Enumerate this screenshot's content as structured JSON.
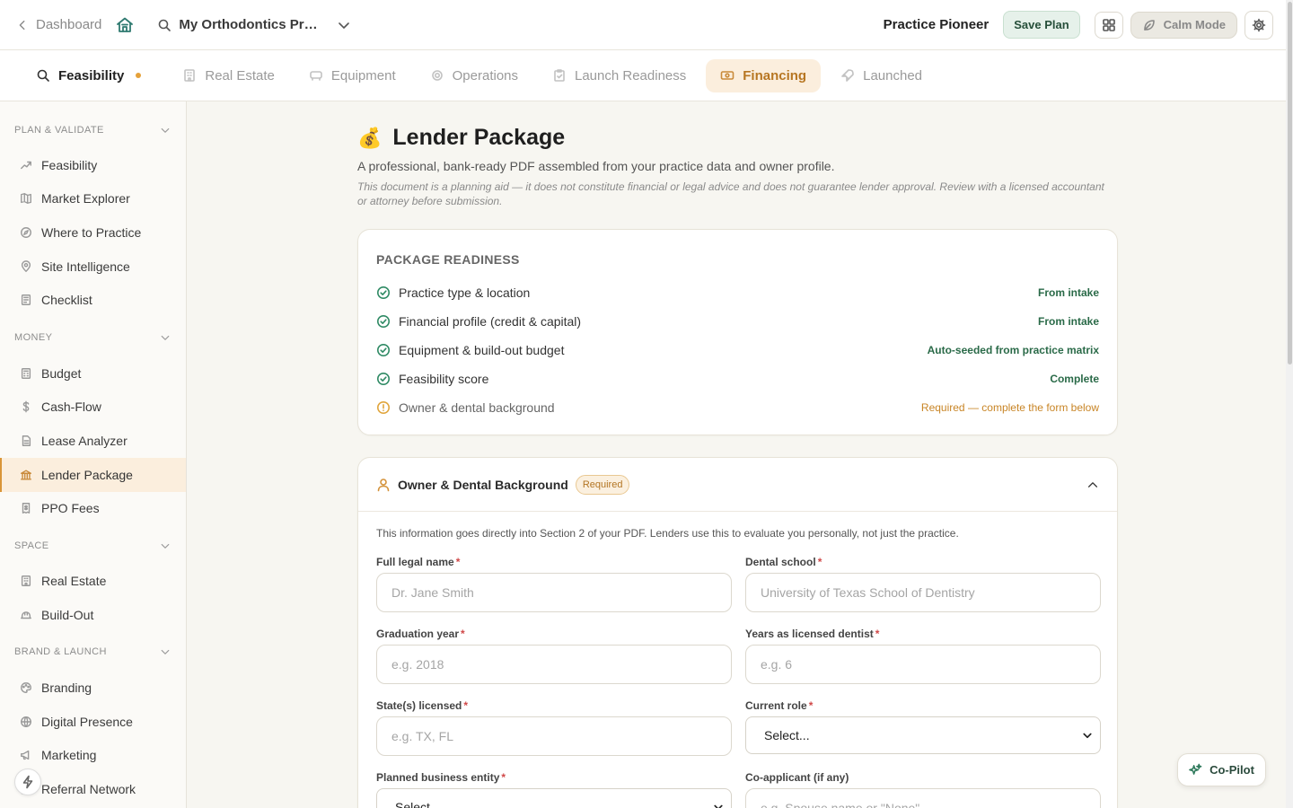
{
  "topbar": {
    "back_label": "Dashboard",
    "project_name": "My Orthodontics Practi...",
    "plan_name": "Practice Pioneer",
    "save_label": "Save Plan",
    "calm_label": "Calm Mode"
  },
  "tabs": [
    {
      "label": "Feasibility",
      "icon": "search-icon",
      "status_dot": true
    },
    {
      "label": "Real Estate",
      "icon": "building-icon"
    },
    {
      "label": "Equipment",
      "icon": "equipment-icon"
    },
    {
      "label": "Operations",
      "icon": "gear-icon"
    },
    {
      "label": "Launch Readiness",
      "icon": "clipboard-icon"
    },
    {
      "label": "Financing",
      "icon": "banknote-icon",
      "selected": true
    },
    {
      "label": "Launched",
      "icon": "rocket-icon"
    }
  ],
  "sidebar": {
    "sections": [
      {
        "title": "PLAN & VALIDATE",
        "items": [
          {
            "label": "Feasibility",
            "icon": "trend-icon"
          },
          {
            "label": "Market Explorer",
            "icon": "map-icon"
          },
          {
            "label": "Where to Practice",
            "icon": "compass-icon"
          },
          {
            "label": "Site Intelligence",
            "icon": "pin-icon"
          },
          {
            "label": "Checklist",
            "icon": "checklist-icon"
          }
        ]
      },
      {
        "title": "MONEY",
        "items": [
          {
            "label": "Budget",
            "icon": "calculator-icon"
          },
          {
            "label": "Cash-Flow",
            "icon": "dollar-icon"
          },
          {
            "label": "Lease Analyzer",
            "icon": "document-icon"
          },
          {
            "label": "Lender Package",
            "icon": "bank-icon",
            "selected": true
          },
          {
            "label": "PPO Fees",
            "icon": "receipt-icon"
          }
        ]
      },
      {
        "title": "SPACE",
        "items": [
          {
            "label": "Real Estate",
            "icon": "building-icon"
          },
          {
            "label": "Build-Out",
            "icon": "hardhat-icon"
          }
        ]
      },
      {
        "title": "BRAND & LAUNCH",
        "items": [
          {
            "label": "Branding",
            "icon": "palette-icon"
          },
          {
            "label": "Digital Presence",
            "icon": "globe-icon"
          },
          {
            "label": "Marketing",
            "icon": "megaphone-icon"
          },
          {
            "label": "Referral Network",
            "icon": "network-icon"
          }
        ]
      }
    ]
  },
  "page": {
    "emoji": "💰",
    "title": "Lender Package",
    "subtitle": "A professional, bank-ready PDF assembled from your practice data and owner profile.",
    "disclaimer": "This document is a planning aid — it does not constitute financial or legal advice and does not guarantee lender approval. Review with a licensed accountant or attorney before submission."
  },
  "readiness": {
    "title": "PACKAGE READINESS",
    "rows": [
      {
        "label": "Practice type & location",
        "status": "From intake",
        "state": "done"
      },
      {
        "label": "Financial profile (credit & capital)",
        "status": "From intake",
        "state": "done"
      },
      {
        "label": "Equipment & build-out budget",
        "status": "Auto-seeded from practice matrix",
        "state": "done"
      },
      {
        "label": "Feasibility score",
        "status": "Complete",
        "state": "done"
      },
      {
        "label": "Owner & dental background",
        "status": "Required — complete the form below",
        "state": "required"
      }
    ]
  },
  "owner_form": {
    "title": "Owner & Dental Background",
    "badge": "Required",
    "intro": "This information goes directly into Section 2 of your PDF. Lenders use this to evaluate you personally, not just the practice.",
    "fields": {
      "full_name": {
        "label": "Full legal name",
        "placeholder": "Dr. Jane Smith"
      },
      "dental_school": {
        "label": "Dental school",
        "placeholder": "University of Texas School of Dentistry"
      },
      "grad_year": {
        "label": "Graduation year",
        "placeholder": "e.g. 2018"
      },
      "years_licensed": {
        "label": "Years as licensed dentist",
        "placeholder": "e.g. 6"
      },
      "states": {
        "label": "State(s) licensed",
        "placeholder": "e.g. TX, FL"
      },
      "current_role": {
        "label": "Current role",
        "value": "Select..."
      },
      "entity": {
        "label": "Planned business entity",
        "value": "Select..."
      },
      "coapplicant": {
        "label": "Co-applicant (if any)",
        "placeholder": "e.g. Spouse name or \"None\""
      }
    }
  },
  "copilot_label": "Co-Pilot"
}
